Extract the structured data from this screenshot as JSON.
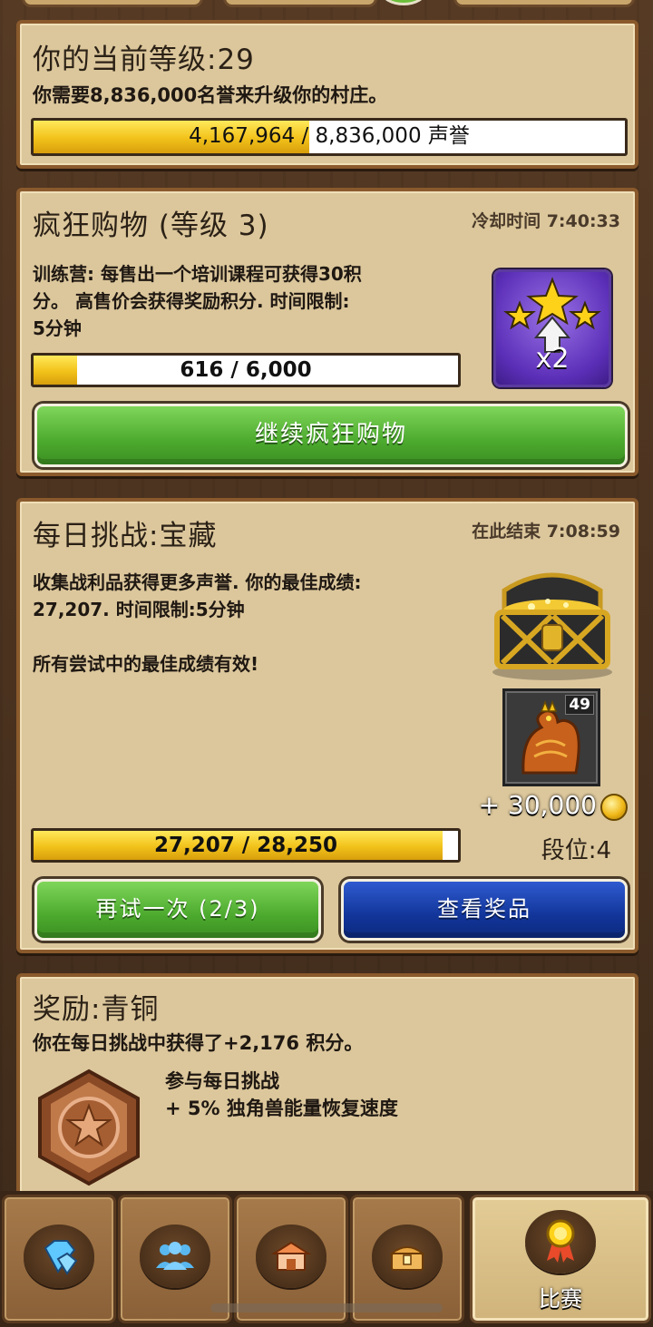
{
  "village": {
    "title": "你的当前等级:29",
    "desc": "你需要8,836,000名誉来升级你的村庄。",
    "progress_value": 4167964,
    "progress_max": 8836000,
    "progress_fraction": 0.467,
    "progress_label": "4,167,964 / 8,836,000 声誉"
  },
  "shopping": {
    "title": "疯狂购物 (等级 3)",
    "cooldown": "冷却时间 7:40:33",
    "desc_line1": "训练营: 每售出一个培训课程可获得30积",
    "desc_line2": "分。 高售价会获得奖励积分. 时间限制:",
    "desc_line3": "5分钟",
    "progress_fraction": 0.103,
    "progress_label": "616 / 6,000",
    "badge_label": "x2",
    "continue_label": "继续疯狂购物"
  },
  "daily": {
    "title": "每日挑战:宝藏",
    "ends": "在此结束 7:08:59",
    "desc_line1": "收集战利品获得更多声誉. 你的最佳成绩:",
    "desc_line2": "27,207. 时间限制:5分钟",
    "desc_line3": "所有尝试中的最佳成绩有效!",
    "dragon_level": "49",
    "reward_coins": "+ 30,000",
    "rank": "段位:4",
    "progress_fraction": 0.963,
    "progress_label": "27,207 / 28,250",
    "retry_label": "再试一次 (2/3)",
    "prizes_label": "查看奖品"
  },
  "reward": {
    "title": "奖励:青铜",
    "desc": "你在每日挑战中获得了+2,176 积分。",
    "perk_line1": "参与每日挑战",
    "perk_line2": "+ 5% 独角兽能量恢复速度"
  },
  "nav": {
    "items": [
      {
        "icon": "diamond-icon"
      },
      {
        "icon": "people-icon"
      },
      {
        "icon": "shop-icon"
      },
      {
        "icon": "treasure-chest-icon"
      },
      {
        "icon": "medal-icon",
        "label": "比赛",
        "active": true
      }
    ]
  },
  "colors": {
    "panel": "#dcc79c",
    "panel_border": "#8a5a2c",
    "bar_fill": "#f2c21a",
    "green_button": "#4caa2e",
    "blue_button": "#12359a"
  }
}
